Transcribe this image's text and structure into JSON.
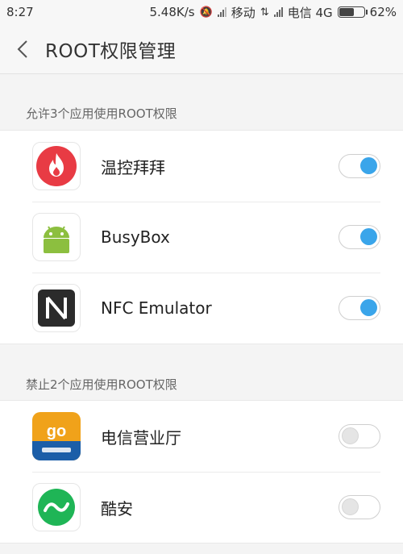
{
  "status_bar": {
    "time": "8:27",
    "speed": "5.48K/s",
    "carrier1": "移动",
    "carrier2": "电信 4G",
    "battery": "62%",
    "battery_level": 0.62
  },
  "header": {
    "title": "ROOT权限管理",
    "back_icon": "chevron-left-icon"
  },
  "allowed_section": {
    "label": "允许3个应用使用ROOT权限",
    "apps": [
      {
        "name": "温控拜拜",
        "icon": "flame-icon",
        "enabled": true
      },
      {
        "name": "BusyBox",
        "icon": "android-icon",
        "enabled": true
      },
      {
        "name": "NFC Emulator",
        "icon": "nfc-icon",
        "enabled": true
      }
    ]
  },
  "denied_section": {
    "label": "禁止2个应用使用ROOT权限",
    "apps": [
      {
        "name": "电信营业厅",
        "icon": "telecom-go-icon",
        "icon_text": "go",
        "enabled": false
      },
      {
        "name": "酷安",
        "icon": "coolapk-icon",
        "enabled": false
      }
    ]
  },
  "colors": {
    "toggle_on": "#3aa5ea",
    "flame_bg": "#e83b44",
    "android_green": "#8cbf3f",
    "coolapk_green": "#1fb556"
  }
}
